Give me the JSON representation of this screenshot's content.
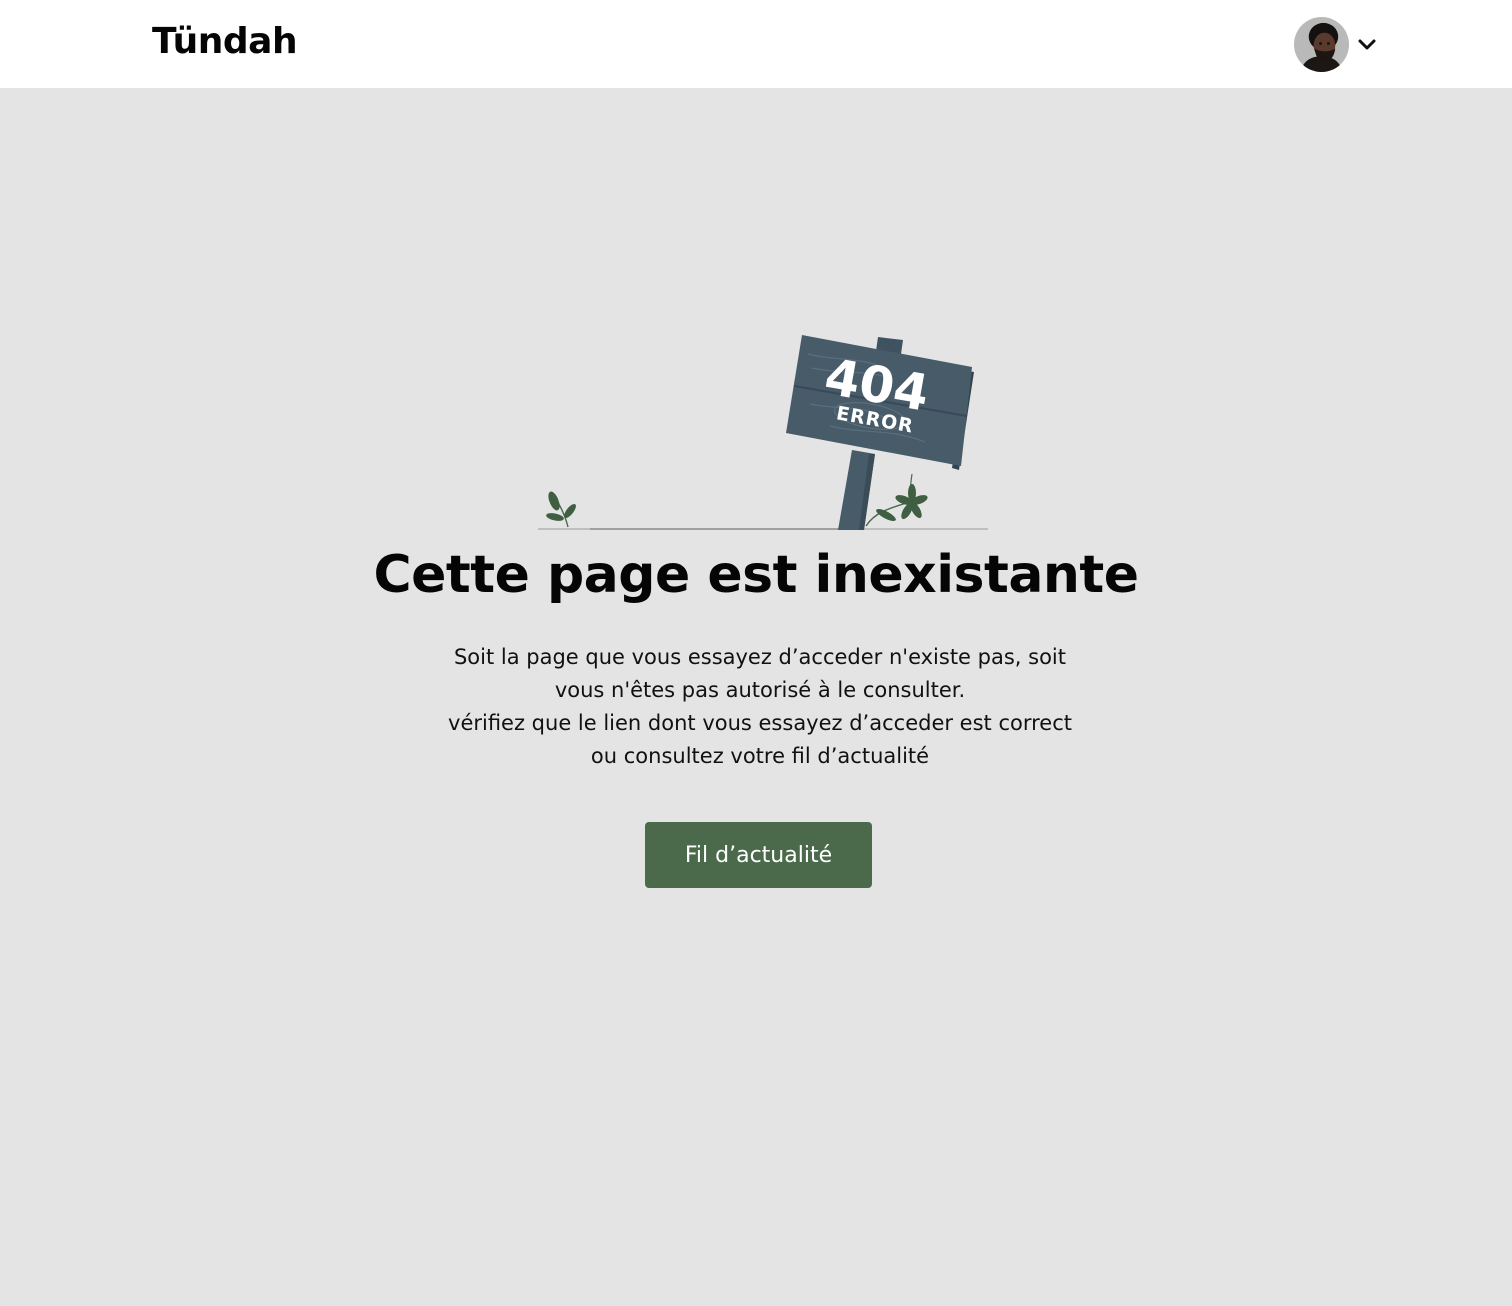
{
  "header": {
    "logo_text": "Tündah",
    "user_avatar_alt": "avatar",
    "chevron_icon": "chevron-down-icon"
  },
  "illustration": {
    "sign_code": "404",
    "sign_label": "ERROR"
  },
  "main": {
    "title": "Cette page est inexistante",
    "message_lines": [
      "Soit la page que vous essayez d’acceder n'existe pas, soit",
      "vous n'êtes pas autorisé à le consulter.",
      "vérifiez que le lien dont vous essayez d’acceder est correct",
      "ou consultez votre fil d’actualité"
    ],
    "cta_label": "Fil d’actualité"
  },
  "colors": {
    "background": "#e4e4e4",
    "topbar": "#ffffff",
    "accent_green": "#4a6a4b",
    "sign_slate": "#475b69"
  }
}
